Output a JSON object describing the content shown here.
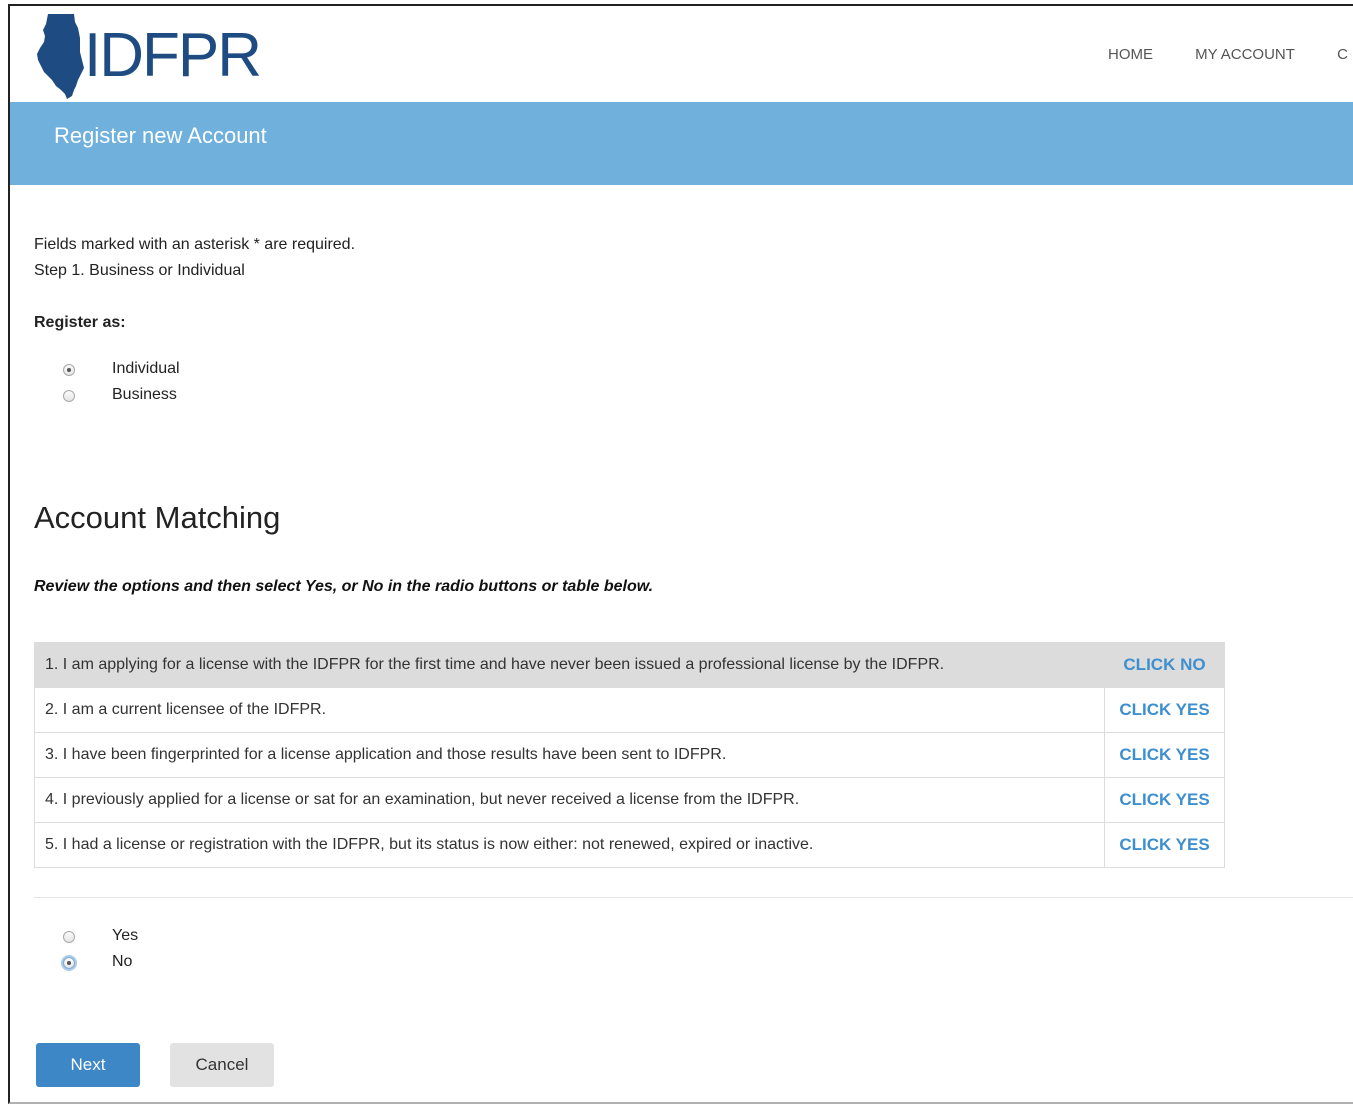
{
  "header": {
    "logo_text": "IDFPR",
    "nav": [
      "HOME",
      "MY ACCOUNT",
      "C"
    ]
  },
  "banner": {
    "title": "Register new Account"
  },
  "form": {
    "required_note": "Fields marked with an asterisk * are required.",
    "step": "Step 1. Business or Individual",
    "register_as_label": "Register as:",
    "register_options": [
      {
        "label": "Individual",
        "checked": true
      },
      {
        "label": "Business",
        "checked": false
      }
    ]
  },
  "matching": {
    "heading": "Account Matching",
    "instructions": "Review the options and then select Yes, or No in the radio buttons or table below.",
    "options": [
      {
        "text": "1. I am applying for a license with the IDFPR for the first time and have never been issued a professional license by the IDFPR.",
        "action": "CLICK NO",
        "selected": true
      },
      {
        "text": "2. I am a current licensee of the IDFPR.",
        "action": "CLICK YES",
        "selected": false
      },
      {
        "text": "3. I have been fingerprinted for a license application and those results have been sent to IDFPR.",
        "action": "CLICK YES",
        "selected": false
      },
      {
        "text": "4. I previously applied for a license or sat for an examination, but never received a license from the IDFPR.",
        "action": "CLICK YES",
        "selected": false
      },
      {
        "text": "5. I had a license or registration with the IDFPR, but its status is now either: not renewed, expired or inactive.",
        "action": "CLICK YES",
        "selected": false
      }
    ],
    "answer_options": [
      {
        "label": "Yes",
        "checked": false
      },
      {
        "label": "No",
        "checked": true
      }
    ]
  },
  "buttons": {
    "next": "Next",
    "cancel": "Cancel"
  },
  "colors": {
    "brand": "#1e4c82",
    "banner": "#6fb1dc",
    "link": "#3e8fcf",
    "primary_button": "#3d87c7",
    "selected_row": "#dcdcdc"
  }
}
